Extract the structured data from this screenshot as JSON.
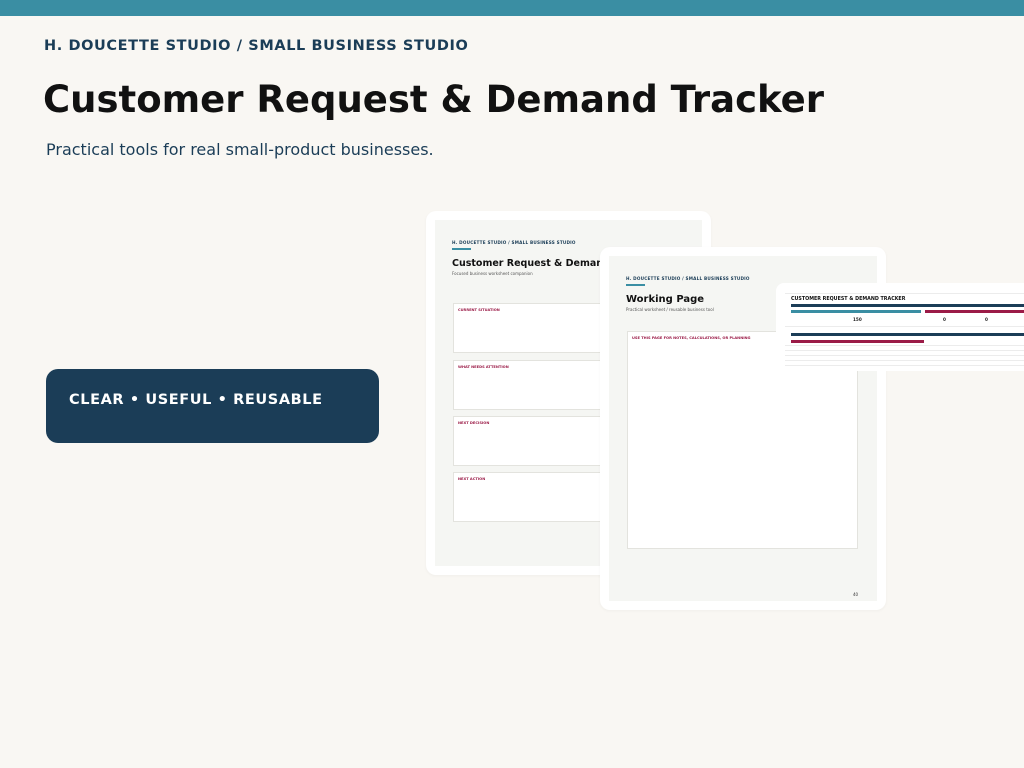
{
  "header": {
    "brand": "H. DOUCETTE STUDIO / SMALL BUSINESS STUDIO",
    "title": "Customer Request & Demand Tracker",
    "subtitle": "Practical tools for real small-product businesses."
  },
  "badge": {
    "text": "CLEAR • USEFUL • REUSABLE"
  },
  "preview_one": {
    "brand": "H. DOUCETTE STUDIO / SMALL BUSINESS STUDIO",
    "title": "Customer Request & Demand T",
    "subtitle": "Focused business worksheet companion",
    "sections": [
      "CURRENT SITUATION",
      "WHAT NEEDS ATTENTION",
      "NEXT DECISION",
      "NEXT ACTION"
    ]
  },
  "preview_two": {
    "brand": "H. DOUCETTE STUDIO / SMALL BUSINESS STUDIO",
    "title": "Working Page",
    "subtitle": "Practical worksheet / reusable business tool",
    "box_label": "USE THIS PAGE FOR NOTES, CALCULATIONS, OR PLANNING",
    "page_number": "40"
  },
  "preview_sheet": {
    "title": "CUSTOMER REQUEST & DEMAND TRACKER",
    "values": [
      "150",
      "0",
      "0"
    ]
  },
  "colors": {
    "top_bar": "#3a8ea3",
    "navy": "#1b3d57",
    "accent_red": "#9b1b47",
    "background": "#f9f7f3"
  }
}
